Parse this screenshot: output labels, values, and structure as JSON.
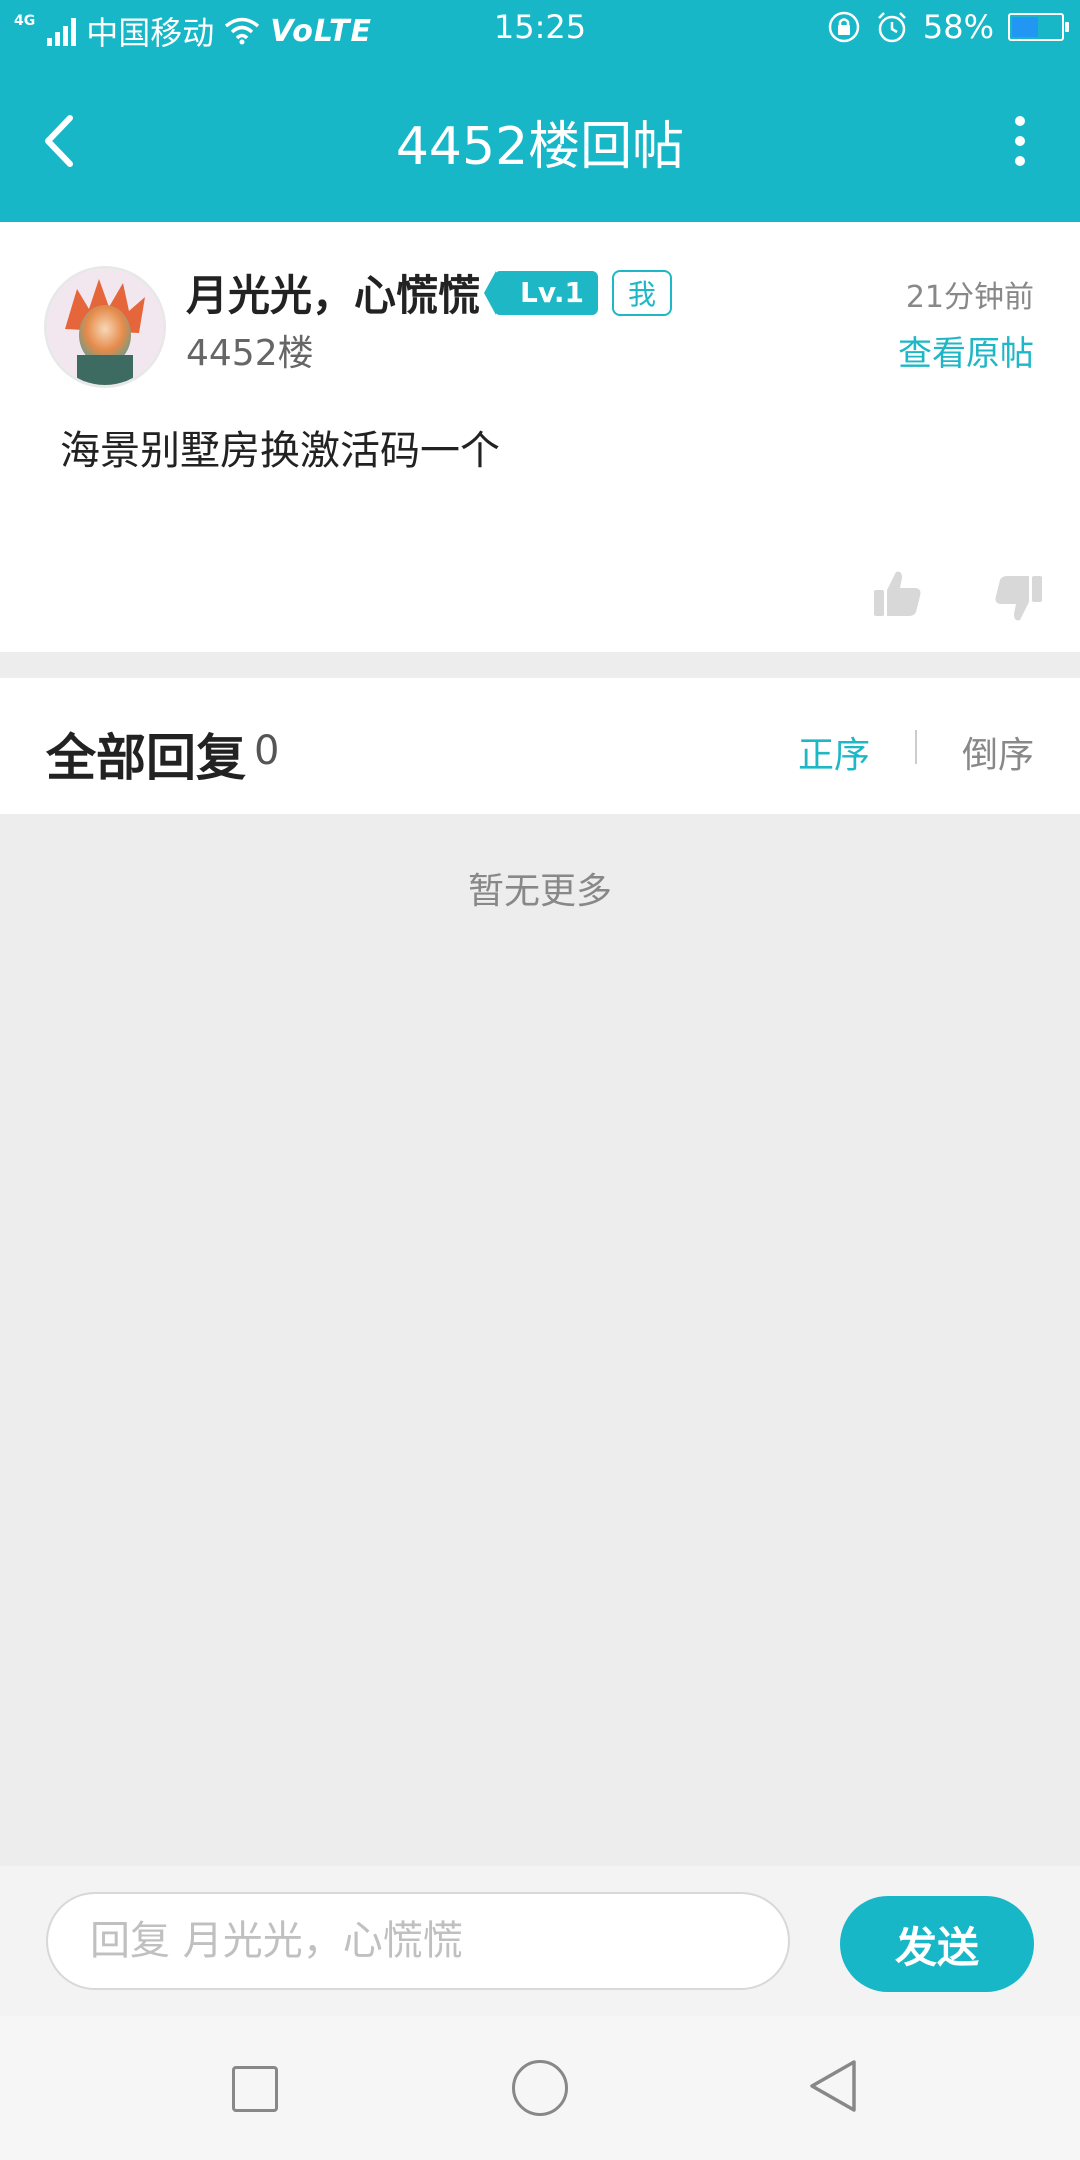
{
  "status_bar": {
    "network": "4G",
    "carrier": "中国移动",
    "volte": "VoLTE",
    "time": "15:25",
    "battery": "58%",
    "battery_level": 0.58,
    "icons": [
      "signal-icon",
      "wifi-icon",
      "rotation-lock-icon",
      "alarm-icon",
      "battery-icon"
    ]
  },
  "header": {
    "title": "4452楼回帖",
    "back_icon": "back-arrow-icon",
    "more_icon": "more-vertical-icon"
  },
  "post": {
    "author": "月光光，心慌慌",
    "level": "Lv.1",
    "me_badge": "我",
    "floor": "4452楼",
    "time": "21分钟前",
    "view_original": "查看原帖",
    "content": "海景别墅房换激活码一个",
    "like_icon": "thumbs-up-icon",
    "dislike_icon": "thumbs-down-icon"
  },
  "replies": {
    "title": "全部回复",
    "count": "0",
    "sort_asc": "正序",
    "sort_desc": "倒序",
    "empty_text": "暂无更多"
  },
  "reply_bar": {
    "placeholder": "回复 月光光，心慌慌",
    "send_label": "发送"
  },
  "colors": {
    "accent": "#17b7c8",
    "background": "#ededed"
  }
}
